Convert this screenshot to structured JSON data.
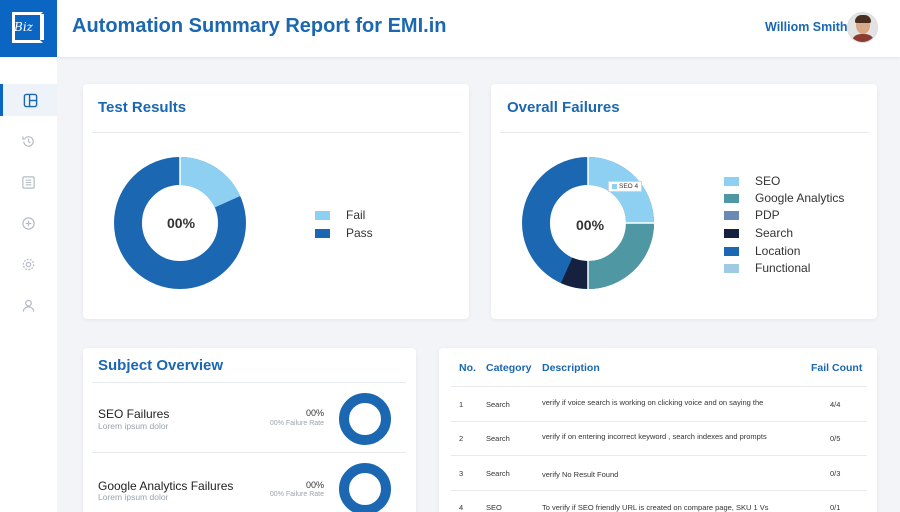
{
  "header": {
    "title": "Automation Summary Report for EMI.in",
    "logo_text": "Biz",
    "user_name": "Williom Smith"
  },
  "sidebar": {
    "items": [
      {
        "icon": "dashboard-icon",
        "active": true
      },
      {
        "icon": "history-icon",
        "active": false
      },
      {
        "icon": "list-icon",
        "active": false
      },
      {
        "icon": "add-circle-icon",
        "active": false
      },
      {
        "icon": "settings-icon",
        "active": false
      },
      {
        "icon": "user-icon",
        "active": false
      }
    ]
  },
  "test_results": {
    "title": "Test Results",
    "center_label": "00%",
    "legend": [
      {
        "label": "Fail",
        "color": "#8dd0f2"
      },
      {
        "label": "Pass",
        "color": "#1b67b1"
      }
    ]
  },
  "overall_failures": {
    "title": "Overall Failures",
    "center_label": "00%",
    "tooltip": "SEO 4",
    "legend": [
      {
        "label": "SEO",
        "color": "#8dd0f2"
      },
      {
        "label": "Google Analytics",
        "color": "#4f98a3"
      },
      {
        "label": "PDP",
        "color": "#6b89b5"
      },
      {
        "label": "Search",
        "color": "#16203f"
      },
      {
        "label": "Location",
        "color": "#1b67b1"
      },
      {
        "label": "Functional",
        "color": "#9ecbe3"
      }
    ]
  },
  "subject_overview": {
    "title": "Subject Overview",
    "items": [
      {
        "name": "SEO Failures",
        "sub": "Lorem ipsum dolor",
        "pct": "00%",
        "rate": "00% Failure Rate"
      },
      {
        "name": "Google Analytics Failures",
        "sub": "Lorem ipsum dolor",
        "pct": "00%",
        "rate": "00% Failure Rate"
      }
    ]
  },
  "failures_table": {
    "headers": {
      "no": "No.",
      "category": "Category",
      "description": "Description",
      "fail_count": "Fail Count"
    },
    "rows": [
      {
        "no": "1",
        "category": "Search",
        "description": "verify if voice search is working on clicking voice and on saying the",
        "fail_count": "4/4"
      },
      {
        "no": "2",
        "category": "Search",
        "description": "verify if on entering incorrect keyword , search indexes and prompts",
        "fail_count": "0/5"
      },
      {
        "no": "3",
        "category": "Search",
        "description": "verify No Result Found",
        "fail_count": "0/3"
      },
      {
        "no": "4",
        "category": "SEO",
        "description": "To verify if SEO friendly URL is created on compare page, SKU 1 Vs",
        "fail_count": "0/1"
      }
    ]
  }
}
